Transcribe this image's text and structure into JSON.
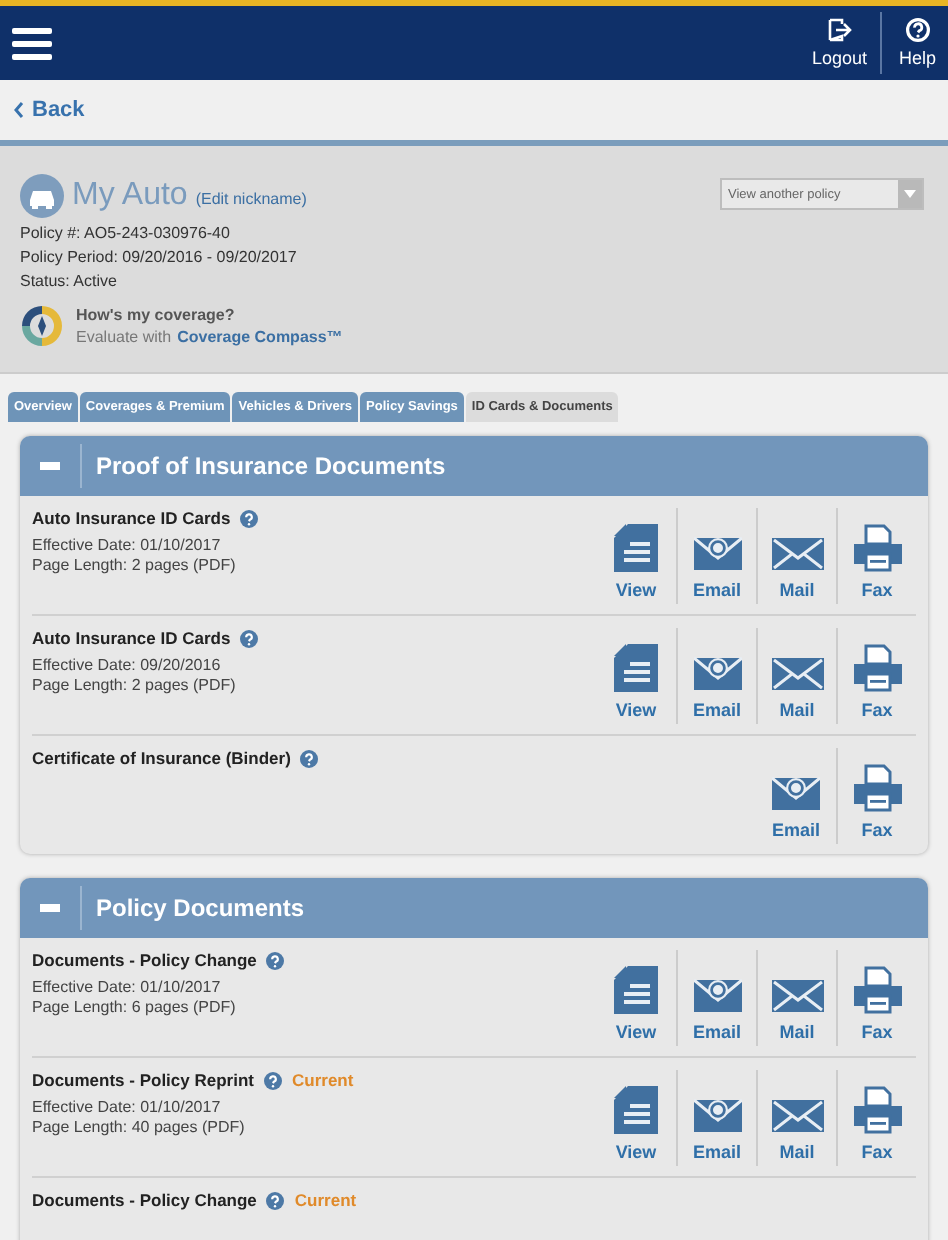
{
  "header": {
    "actions": [
      {
        "kind": "logout",
        "label": "Logout"
      },
      {
        "kind": "help",
        "label": "Help"
      }
    ]
  },
  "back_link": "Back",
  "policy": {
    "title": "My Auto",
    "edit_link": "(Edit nickname)",
    "details": [
      "Policy #: AO5-243-030976-40",
      "Policy Period: 09/20/2016 - 09/20/2017",
      "Status: Active"
    ],
    "policy_select": {
      "placeholder": "View another policy"
    },
    "coverage": {
      "question": "How's my coverage?",
      "prompt": "Evaluate with",
      "link": "Coverage Compass™"
    }
  },
  "tabs": [
    {
      "label": "Overview",
      "selected": false
    },
    {
      "label": "Coverages & Premium",
      "selected": false
    },
    {
      "label": "Vehicles & Drivers",
      "selected": false
    },
    {
      "label": "Policy Savings",
      "selected": false
    },
    {
      "label": "ID Cards & Documents",
      "selected": true
    }
  ],
  "sections": [
    {
      "title": "Proof of Insurance Documents",
      "expanded": true,
      "documents": [
        {
          "title": "Auto Insurance ID Cards",
          "details": [
            "Effective Date: 01/10/2017",
            "Page Length: 2 pages (PDF)"
          ],
          "actions": [
            {
              "kind": "view",
              "label": "View"
            },
            {
              "kind": "email",
              "label": "Email"
            },
            {
              "kind": "mail",
              "label": "Mail"
            },
            {
              "kind": "fax",
              "label": "Fax"
            }
          ]
        },
        {
          "title": "Auto Insurance ID Cards",
          "details": [
            "Effective Date: 09/20/2016",
            "Page Length: 2 pages (PDF)"
          ],
          "actions": [
            {
              "kind": "view",
              "label": "View"
            },
            {
              "kind": "email",
              "label": "Email"
            },
            {
              "kind": "mail",
              "label": "Mail"
            },
            {
              "kind": "fax",
              "label": "Fax"
            }
          ]
        },
        {
          "title": "Certificate of Insurance (Binder)",
          "actions": [
            {
              "kind": "email",
              "label": "Email"
            },
            {
              "kind": "fax",
              "label": "Fax"
            }
          ]
        }
      ]
    },
    {
      "title": "Policy Documents",
      "expanded": true,
      "documents": [
        {
          "title": "Documents - Policy Change",
          "details": [
            "Effective Date: 01/10/2017",
            "Page Length: 6 pages (PDF)"
          ],
          "actions": [
            {
              "kind": "view",
              "label": "View"
            },
            {
              "kind": "email",
              "label": "Email"
            },
            {
              "kind": "mail",
              "label": "Mail"
            },
            {
              "kind": "fax",
              "label": "Fax"
            }
          ]
        },
        {
          "title": "Documents - Policy Reprint",
          "badge": "Current",
          "details": [
            "Effective Date: 01/10/2017",
            "Page Length: 40 pages (PDF)"
          ],
          "actions": [
            {
              "kind": "view",
              "label": "View"
            },
            {
              "kind": "email",
              "label": "Email"
            },
            {
              "kind": "mail",
              "label": "Mail"
            },
            {
              "kind": "fax",
              "label": "Fax"
            }
          ]
        },
        {
          "title": "Documents - Policy Change",
          "badge": "Current"
        }
      ]
    }
  ]
}
